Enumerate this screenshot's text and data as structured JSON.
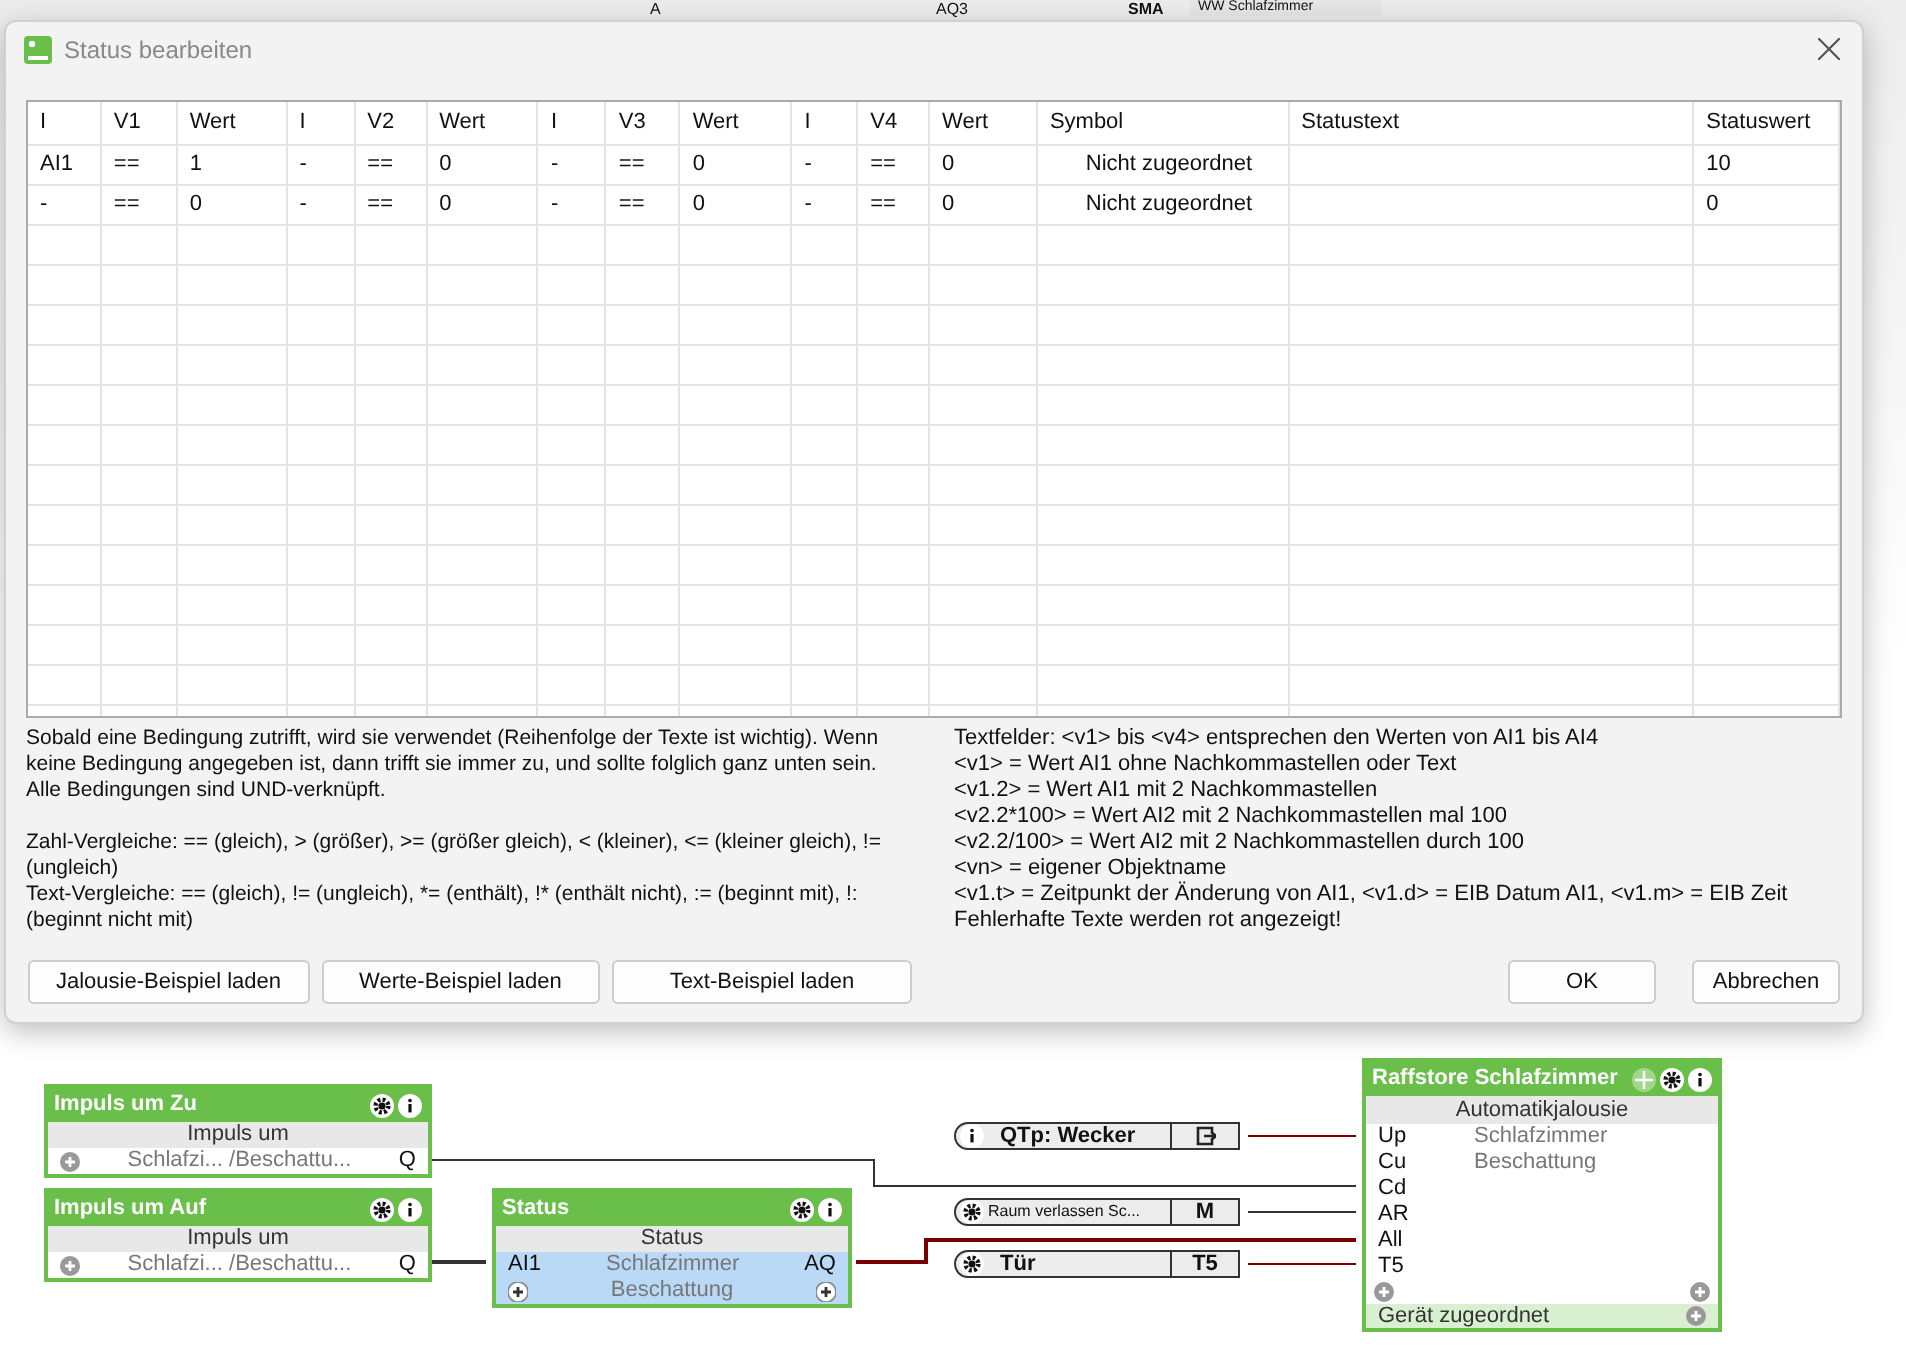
{
  "background_strip": {
    "input": "A",
    "output": "AQ3",
    "block": "SMA",
    "name": "WW Schlafzimmer"
  },
  "dialog": {
    "title": "Status bearbeiten",
    "columns": [
      "I",
      "V1",
      "Wert",
      "I",
      "V2",
      "Wert",
      "I",
      "V3",
      "Wert",
      "I",
      "V4",
      "Wert",
      "Symbol",
      "Statustext",
      "Statuswert"
    ],
    "rows": [
      [
        "AI1",
        "==",
        "1",
        "-",
        "==",
        "0",
        "-",
        "==",
        "0",
        "-",
        "==",
        "0",
        "Nicht zugeordnet",
        "",
        "10"
      ],
      [
        "-",
        "==",
        "0",
        "-",
        "==",
        "0",
        "-",
        "==",
        "0",
        "-",
        "==",
        "0",
        "Nicht zugeordnet",
        "",
        "0"
      ]
    ],
    "help_left": [
      [
        "Sobald eine Bedingung zutrifft, wird sie verwendet (Reihenfolge der Texte ist wichtig). Wenn keine Bedingung angegeben ist, dann trifft sie immer zu, und sollte folglich ganz unten sein.",
        "Alle Bedingungen sind UND-verknüpft."
      ],
      [
        "Zahl-Vergleiche: == (gleich), > (größer), >= (größer gleich), < (kleiner), <= (kleiner gleich), != (ungleich)",
        "Text-Vergleiche: == (gleich), != (ungleich), *= (enthält), !* (enthält nicht), := (beginnt mit), !: (beginnt nicht mit)"
      ]
    ],
    "help_right": [
      "Textfelder: <v1> bis <v4> entsprechen den Werten von AI1 bis AI4",
      "<v1> = Wert AI1 ohne Nachkommastellen oder Text",
      "<v1.2> = Wert AI1 mit 2 Nachkommastellen",
      "<v2.2*100> = Wert AI2 mit 2 Nachkommastellen mal 100",
      "<v2.2/100> = Wert AI2 mit 2 Nachkommastellen durch 100",
      "<vn> = eigener Objektname",
      "<v1.t> = Zeitpunkt der Änderung von AI1, <v1.d> = EIB Datum AI1, <v1.m> = EIB Zeit",
      "Fehlerhafte Texte werden rot angezeigt!"
    ],
    "buttons_left": [
      "Jalousie-Beispiel laden",
      "Werte-Beispiel laden",
      "Text-Beispiel laden"
    ],
    "buttons_right": [
      "OK",
      "Abbrechen"
    ]
  },
  "blocks": [
    {
      "title": "Impuls um Zu",
      "type": "Impuls um",
      "lines": [
        {
          "text": "Schlafzi... /Beschattu...",
          "output": "Q",
          "highlight": false
        }
      ]
    },
    {
      "title": "Impuls um Auf",
      "type": "Impuls um",
      "lines": [
        {
          "text": "Schlafzi... /Beschattu...",
          "output": "Q",
          "highlight": false
        }
      ]
    },
    {
      "title": "Status",
      "type": "Status",
      "lines": [
        {
          "input": "AI1",
          "text": "Schlafzimmer",
          "output": "AQ",
          "highlight": true
        },
        {
          "text": "Beschattung",
          "highlight": true
        }
      ]
    }
  ],
  "references": [
    {
      "kind": "output",
      "label": "QTp: Wecker"
    },
    {
      "kind": "parameter",
      "label": "Raum verlassen Sc...",
      "tag": "M"
    },
    {
      "kind": "parameter",
      "label": "Tür",
      "tag": "T5"
    }
  ],
  "actuator": {
    "title": "Raffstore Schlafzimmer",
    "type": "Automatikjalousie",
    "inputs": [
      "Up",
      "Cu",
      "Cd",
      "AR",
      "All",
      "T5"
    ],
    "description": [
      "Schlafzimmer",
      "Beschattung"
    ],
    "footer": "Gerät zugeordnet"
  }
}
